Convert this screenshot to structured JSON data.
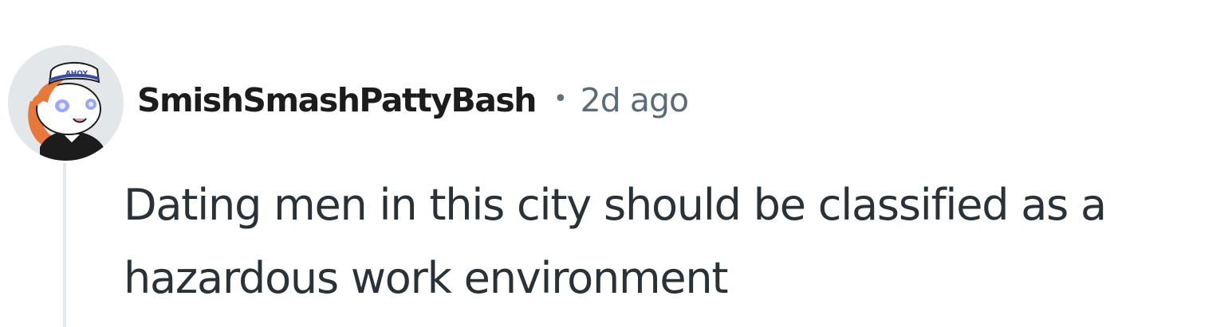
{
  "comment": {
    "username": "SmishSmashPattyBash",
    "separator": "•",
    "timestamp": "2d ago",
    "body": "Dating men in this city should be classified as a hazardous work environment",
    "avatar": {
      "icon": "snoo-sailor-avatar-icon",
      "hat_text": "AHOY"
    }
  }
}
